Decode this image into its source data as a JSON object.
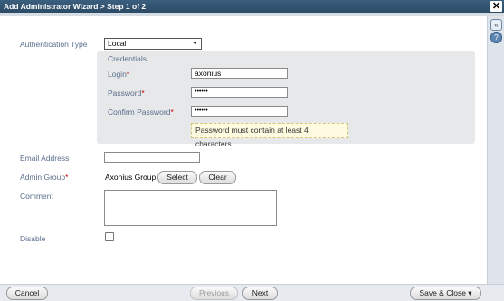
{
  "window": {
    "title": "Add Administrator Wizard > Step 1 of 2",
    "close_glyph": "✕"
  },
  "side": {
    "collapse_glyph": "«",
    "help_glyph": "?"
  },
  "form": {
    "auth_type_label": "Authentication Type",
    "auth_type_value": "Local",
    "credentials_heading": "Credentials",
    "login_label": "Login",
    "login_value": "axonius",
    "password_label": "Password",
    "password_value": "••••••",
    "confirm_label": "Confirm Password",
    "confirm_value": "••••••",
    "password_hint": "Password must contain at least 4 characters.",
    "email_label": "Email Address",
    "email_value": "",
    "group_label": "Admin Group",
    "group_value": "Axonius Group",
    "select_label": "Select",
    "clear_label": "Clear",
    "comment_label": "Comment",
    "comment_value": "",
    "disable_label": "Disable",
    "required_mark": "*"
  },
  "footer": {
    "cancel_label": "Cancel",
    "previous_label": "Previous",
    "next_label": "Next",
    "save_label": "Save & Close ▾"
  }
}
